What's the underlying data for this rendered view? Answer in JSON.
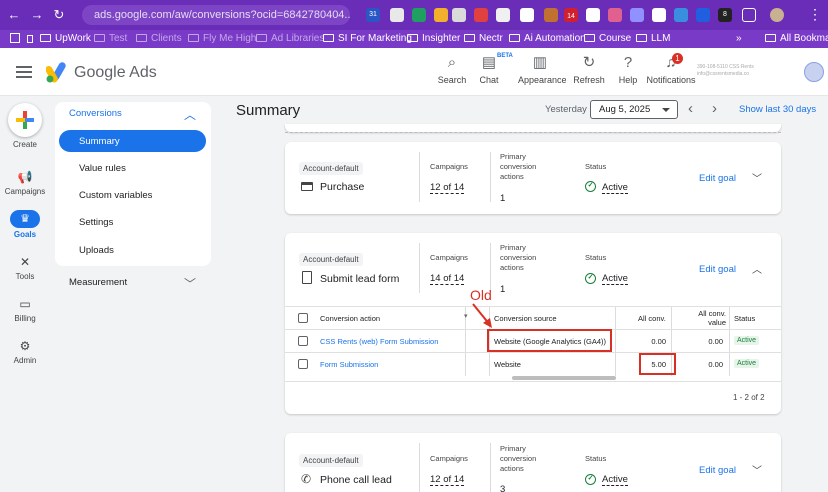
{
  "browser": {
    "url": "ads.google.com/aw/conversions?ocid=6842780404...",
    "badges": {
      "calendar": "31",
      "ext_count": "14",
      "eight": "8"
    },
    "bookmarks": [
      "UpWork",
      "Test",
      "Clients",
      "Fly Me High",
      "Ad Libraries",
      "SI For Marketing",
      "Insighter",
      "Nectr",
      "Ai Automation",
      "Course",
      "LLM",
      "All Bookmarks"
    ]
  },
  "header": {
    "brand": "Google Ads",
    "buttons": [
      {
        "label": "Search",
        "icon": "search-icon"
      },
      {
        "label": "Chat",
        "icon": "chat-icon"
      },
      {
        "label": "Appearance",
        "icon": "appearance-icon"
      },
      {
        "label": "Refresh",
        "icon": "refresh-icon"
      },
      {
        "label": "Help",
        "icon": "help-icon"
      },
      {
        "label": "Notifications",
        "icon": "bell-icon"
      }
    ],
    "beta": "BETA",
    "notif_count": "1",
    "account_line1": "390-108-5110 CSS Rents",
    "account_line2": "info@cssrentsmedia.co"
  },
  "rail": {
    "create": "Create",
    "campaigns": "Campaigns",
    "goals": "Goals",
    "tools": "Tools",
    "billing": "Billing",
    "admin": "Admin"
  },
  "nav": {
    "section": "Conversions",
    "items": [
      "Summary",
      "Value rules",
      "Custom variables",
      "Settings",
      "Uploads"
    ],
    "measurement": "Measurement"
  },
  "summary": {
    "title": "Summary",
    "yesterday": "Yesterday",
    "date": "Aug 5, 2025",
    "last30": "Show last 30 days"
  },
  "labels": {
    "campaigns": "Campaigns",
    "primary1": "Primary",
    "primary2": "conversion",
    "primary3": "actions",
    "status": "Status",
    "edit": "Edit goal"
  },
  "goals": [
    {
      "chip": "Account-default",
      "name": "Purchase",
      "campaigns": "12 of 14",
      "primary": "1",
      "status": "Active",
      "icon": "card-icon"
    },
    {
      "chip": "Account-default",
      "name": "Submit lead form",
      "campaigns": "14 of 14",
      "primary": "1",
      "status": "Active",
      "icon": "form-icon"
    },
    {
      "chip": "Account-default",
      "name": "Phone call lead",
      "campaigns": "12 of 14",
      "primary": "3",
      "status": "Active",
      "icon": "phone-icon"
    }
  ],
  "table": {
    "headers": {
      "action": "Conversion action",
      "source": "Conversion source",
      "allconv": "All conv.",
      "allval1": "All conv.",
      "allval2": "value",
      "status": "Status"
    },
    "rows": [
      {
        "action": "CSS Rents (web) Form Submission",
        "source": "Website (Google Analytics (GA4))",
        "allconv": "0.00",
        "allval": "0.00",
        "status": "Active"
      },
      {
        "action": "Form Submission",
        "source": "Website",
        "allconv": "5.00",
        "allval": "0.00",
        "status": "Active"
      }
    ],
    "pagination": "1 - 2 of 2"
  },
  "annotation": "Old",
  "colors": {
    "accent": "#1a73e8",
    "active": "#188038",
    "annotation": "#d93025",
    "chrome": "#6a2db8"
  }
}
